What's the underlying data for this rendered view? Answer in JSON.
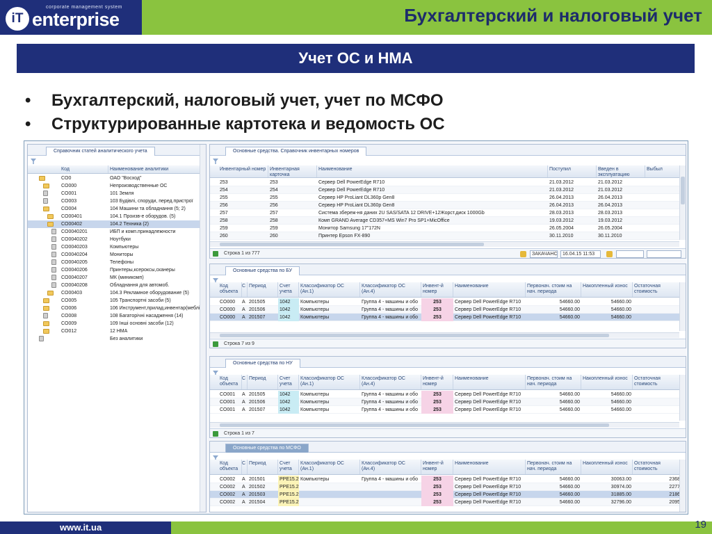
{
  "header": {
    "logo_mark": "iT",
    "logo_brand": "enterprise",
    "logo_tagline": "corporate management system",
    "title": "Бухгалтерский и налоговый учет",
    "subtitle": "Учет ОС и НМА"
  },
  "bullets": [
    "Бухгалтерский, налоговый учет, учет по МСФО",
    "Структурированные картотека и ведомость ОС"
  ],
  "footer": {
    "url": "www.it.ua",
    "page": "19"
  },
  "colors": {
    "navy": "#1f2f7a",
    "green": "#8ac33f"
  },
  "app": {
    "left_panel": {
      "tab": "Справочник статей аналитического учета",
      "columns": [
        "Код",
        "Наименование аналитики"
      ],
      "rows": [
        {
          "code": "CO0",
          "name": "ОАО \"Восход\"",
          "icon": "folder-icon",
          "level": 0
        },
        {
          "code": "CO000",
          "name": "Непроизводственные ОС",
          "icon": "folder-icon",
          "level": 1
        },
        {
          "code": "CO001",
          "name": "101 Земля",
          "icon": "doc-icon",
          "level": 1
        },
        {
          "code": "CO003",
          "name": "103 Будівлі, споруди, перед.пристрої",
          "icon": "doc-icon",
          "level": 1
        },
        {
          "code": "CO004",
          "name": "104 Машини та обладнання (5; 2)",
          "icon": "folder-icon",
          "level": 1
        },
        {
          "code": "CO00401",
          "name": "104.1 Произв-е оборудов. (5)",
          "icon": "folder-icon",
          "level": 2
        },
        {
          "code": "CO00402",
          "name": "104.2 Техника (2)",
          "icon": "folder-icon",
          "level": 2,
          "selected": true
        },
        {
          "code": "CO0040201",
          "name": "ИБП и комп.принадлежности",
          "icon": "doc-icon",
          "level": 3
        },
        {
          "code": "CO0040202",
          "name": "Ноутбуки",
          "icon": "doc-icon",
          "level": 3
        },
        {
          "code": "CO0040203",
          "name": "Компьютеры",
          "icon": "doc-icon",
          "level": 3
        },
        {
          "code": "CO0040204",
          "name": "Мониторы",
          "icon": "doc-icon",
          "level": 3
        },
        {
          "code": "CO0040205",
          "name": "Телефоны",
          "icon": "doc-icon",
          "level": 3
        },
        {
          "code": "CO0040206",
          "name": "Принтеры,ксероксы,сканеры",
          "icon": "doc-icon",
          "level": 3
        },
        {
          "code": "CO0040207",
          "name": "МК (миникомп)",
          "icon": "doc-icon",
          "level": 3
        },
        {
          "code": "CO0040208",
          "name": "Обладнання для автомоб.",
          "icon": "doc-icon",
          "level": 3
        },
        {
          "code": "CO00403",
          "name": "104.3 Рекламное оборудование (5)",
          "icon": "folder-icon",
          "level": 2
        },
        {
          "code": "CO005",
          "name": "105 Транспортні засоби (5)",
          "icon": "folder-icon",
          "level": 1
        },
        {
          "code": "CO006",
          "name": "106 Инструмент,прилад,инвентар(меблі)",
          "icon": "folder-icon",
          "level": 1
        },
        {
          "code": "CO008",
          "name": "108 Багаторічні насадження (14)",
          "icon": "doc-icon",
          "level": 1
        },
        {
          "code": "CO009",
          "name": "109 Інші основні засоби (12)",
          "icon": "folder-icon",
          "level": 1
        },
        {
          "code": "CO012",
          "name": "12 НМА",
          "icon": "folder-icon",
          "level": 1
        },
        {
          "code": "",
          "name": "Без аналитики",
          "icon": "doc-icon",
          "level": 0
        }
      ]
    },
    "inventory": {
      "tab": "Основные средства. Справочник инвентарных номеров",
      "columns": [
        "Инвентарный номер",
        "Инвентарная карточка",
        "Наименование",
        "Поступил",
        "Введен в эксплуатацию",
        "Выбыл"
      ],
      "rows": [
        {
          "inv": "253",
          "card": "253",
          "name": "Сервер Dell PowerEdge R710",
          "in": "21.03.2012",
          "start": "21.03.2012"
        },
        {
          "inv": "254",
          "card": "254",
          "name": "Сервер Dell PowerEdge R710",
          "in": "21.03.2012",
          "start": "21.03.2012"
        },
        {
          "inv": "255",
          "card": "255",
          "name": "Сервер HP ProLiant DL360p Gen8",
          "in": "26.04.2013",
          "start": "26.04.2013"
        },
        {
          "inv": "256",
          "card": "256",
          "name": "Сервер HP ProLiant DL360p Gen8",
          "in": "26.04.2013",
          "start": "26.04.2013"
        },
        {
          "inv": "257",
          "card": "257",
          "name": "Система збереж-ня даних 2U SAS/SATA 12 DRIVE+12Жорст.диск 1000Gb",
          "in": "28.03.2013",
          "start": "28.03.2013"
        },
        {
          "inv": "258",
          "card": "258",
          "name": "Комп GRAND Average CD357+MS Win7 Pro SP1+MicOffice",
          "in": "19.03.2012",
          "start": "19.03.2012"
        },
        {
          "inv": "259",
          "card": "259",
          "name": "Монитор Samsung 17\"172N",
          "in": "26.05.2004",
          "start": "26.05.2004"
        },
        {
          "inv": "260",
          "card": "260",
          "name": "Принтер Epson FX-890",
          "in": "30.11.2010",
          "start": "30.11.2010"
        }
      ],
      "status": "Строка 1 из 777",
      "search_label": "ЗАКАЧАНС",
      "search_date": "16.04.15 11:53"
    },
    "grids": [
      {
        "tab": "Основные средства по БУ",
        "status": "Строка 7 из 9",
        "rows": [
          {
            "code": "CO000",
            "c": "A",
            "period": "201505",
            "acct": "1042",
            "cls1": "Компьютеры",
            "cls4": "Группа 4 - машины и обо",
            "inv": "253",
            "name": "Сервер Dell PowerEdge R710",
            "cost": "54660.00",
            "wear": "54660.00"
          },
          {
            "code": "CO000",
            "c": "A",
            "period": "201506",
            "acct": "1042",
            "cls1": "Компьютеры",
            "cls4": "Группа 4 - машины и обо",
            "inv": "253",
            "name": "Сервер Dell PowerEdge R710",
            "cost": "54660.00",
            "wear": "54660.00"
          },
          {
            "code": "CO000",
            "c": "A",
            "period": "201507",
            "acct": "1042",
            "cls1": "Компьютеры",
            "cls4": "Группа 4 - машины и обо",
            "inv": "253",
            "name": "Сервер Dell PowerEdge R710",
            "cost": "54660.00",
            "wear": "54660.00",
            "selected": true
          }
        ]
      },
      {
        "tab": "Основные средства по НУ",
        "status": "Строка 1 из 7",
        "rows": [
          {
            "code": "CO001",
            "c": "A",
            "period": "201505",
            "acct": "1042",
            "cls1": "Компьютеры",
            "cls4": "Группа 4 - машины и обо",
            "inv": "253",
            "name": "Сервер Dell PowerEdge R710",
            "cost": "54660.00",
            "wear": "54660.00"
          },
          {
            "code": "CO001",
            "c": "A",
            "period": "201506",
            "acct": "1042",
            "cls1": "Компьютеры",
            "cls4": "Группа 4 - машины и обо",
            "inv": "253",
            "name": "Сервер Dell PowerEdge R710",
            "cost": "54660.00",
            "wear": "54660.00"
          },
          {
            "code": "CO001",
            "c": "A",
            "period": "201507",
            "acct": "1042",
            "cls1": "Компьютеры",
            "cls4": "Группа 4 - машины и обо",
            "inv": "253",
            "name": "Сервер Dell PowerEdge R710",
            "cost": "54660.00",
            "wear": "54660.00"
          }
        ]
      },
      {
        "tab": "Основные средства по МСФО",
        "status": "",
        "rows": [
          {
            "code": "CO002",
            "c": "A",
            "period": "201501",
            "acct": "PPE15.2",
            "cls1": "Компьютеры",
            "cls4": "Группа 4 - машины и обо",
            "inv": "253",
            "name": "Сервер Dell PowerEdge R710",
            "cost": "54660.00",
            "wear": "30063.00",
            "rest": "2368"
          },
          {
            "code": "CO002",
            "c": "A",
            "period": "201502",
            "acct": "PPE15.2",
            "cls1": "",
            "cls4": "",
            "inv": "253",
            "name": "Сервер Dell PowerEdge R710",
            "cost": "54660.00",
            "wear": "30974.00",
            "rest": "2277"
          },
          {
            "code": "CO002",
            "c": "A",
            "period": "201503",
            "acct": "PPE15.2",
            "cls1": "",
            "cls4": "",
            "inv": "253",
            "name": "Сервер Dell PowerEdge R710",
            "cost": "54660.00",
            "wear": "31885.00",
            "rest": "2186",
            "selected": true
          },
          {
            "code": "CO002",
            "c": "A",
            "period": "201504",
            "acct": "PPE15.2",
            "cls1": "",
            "cls4": "",
            "inv": "253",
            "name": "Сервер Dell PowerEdge R710",
            "cost": "54660.00",
            "wear": "32796.00",
            "rest": "2095"
          }
        ]
      }
    ],
    "grid_columns": [
      "Код объекта",
      "С",
      "Период",
      "Счет учета",
      "Классификатор ОС (Ан.1)",
      "Классификатор ОС (Ан.4)",
      "Инвент-й номер",
      "Наименование",
      "Первонач. стоим на нач. периода",
      "Накопленный износ",
      "Остаточная стоимость"
    ]
  }
}
